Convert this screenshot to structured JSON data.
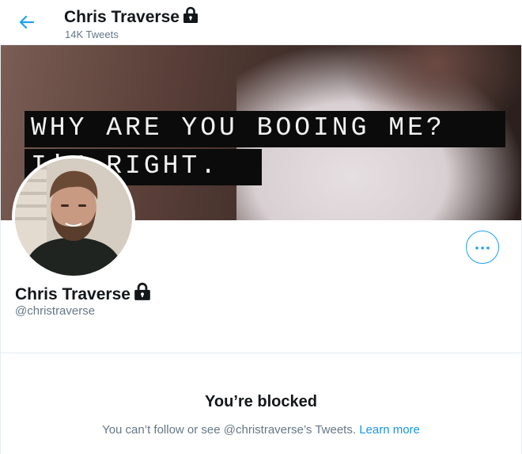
{
  "header": {
    "name": "Chris Traverse",
    "tweet_count": "14K Tweets",
    "protected_icon": "lock-icon",
    "back_icon": "arrow-left-icon"
  },
  "banner": {
    "caption_line1": "WHY ARE YOU BOOING ME?",
    "caption_line2": "I'M RIGHT."
  },
  "profile": {
    "name": "Chris Traverse",
    "handle": "@christraverse",
    "more_icon": "more-icon"
  },
  "blocked": {
    "title": "You’re blocked",
    "message": "You can’t follow or see @christraverse’s Tweets.",
    "link": "Learn more"
  },
  "colors": {
    "accent": "#1da1f2",
    "secondary_text": "#657786",
    "primary_text": "#14171a"
  }
}
